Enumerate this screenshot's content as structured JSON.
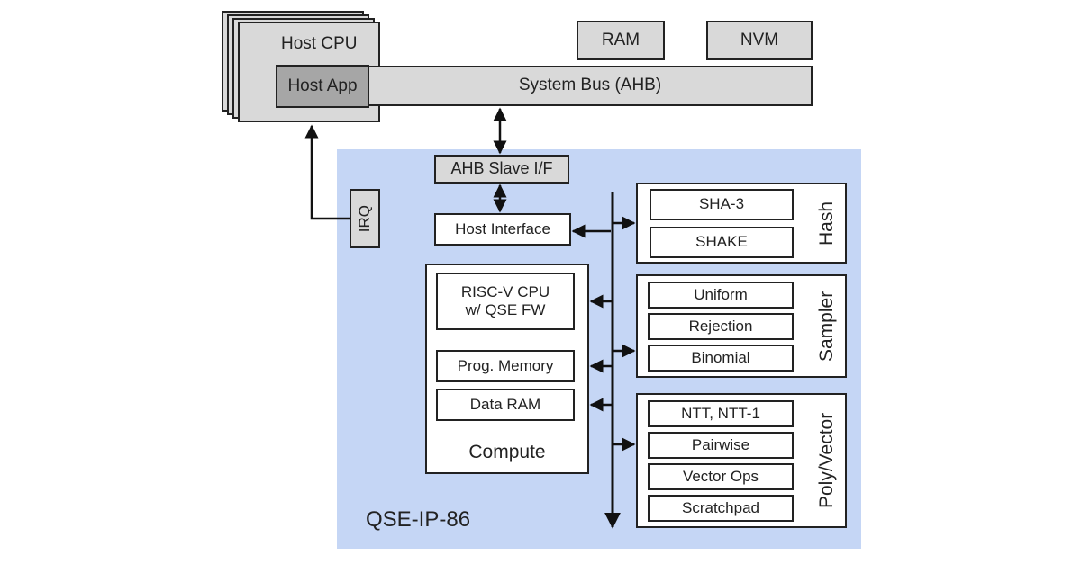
{
  "host": {
    "cpu_label": "Host CPU",
    "app_label": "Host App"
  },
  "memory": {
    "ram_label": "RAM",
    "nvm_label": "NVM"
  },
  "bus": {
    "label": "System Bus (AHB)"
  },
  "irq": {
    "label": "IRQ"
  },
  "ip": {
    "name": "QSE-IP-86",
    "background_color": "#c5d6f5",
    "ahb_slave_label": "AHB Slave I/F",
    "host_interface_label": "Host Interface",
    "compute": {
      "title": "Compute",
      "cpu_label_line1": "RISC-V CPU",
      "cpu_label_line2": "w/ QSE FW",
      "prog_memory_label": "Prog. Memory",
      "data_ram_label": "Data RAM"
    },
    "hash": {
      "title": "Hash",
      "items": [
        "SHA-3",
        "SHAKE"
      ]
    },
    "sampler": {
      "title": "Sampler",
      "items": [
        "Uniform",
        "Rejection",
        "Binomial"
      ]
    },
    "poly": {
      "title": "Poly/Vector",
      "items": [
        "NTT, NTT-1",
        "Pairwise",
        "Vector Ops",
        "Scratchpad"
      ]
    }
  }
}
